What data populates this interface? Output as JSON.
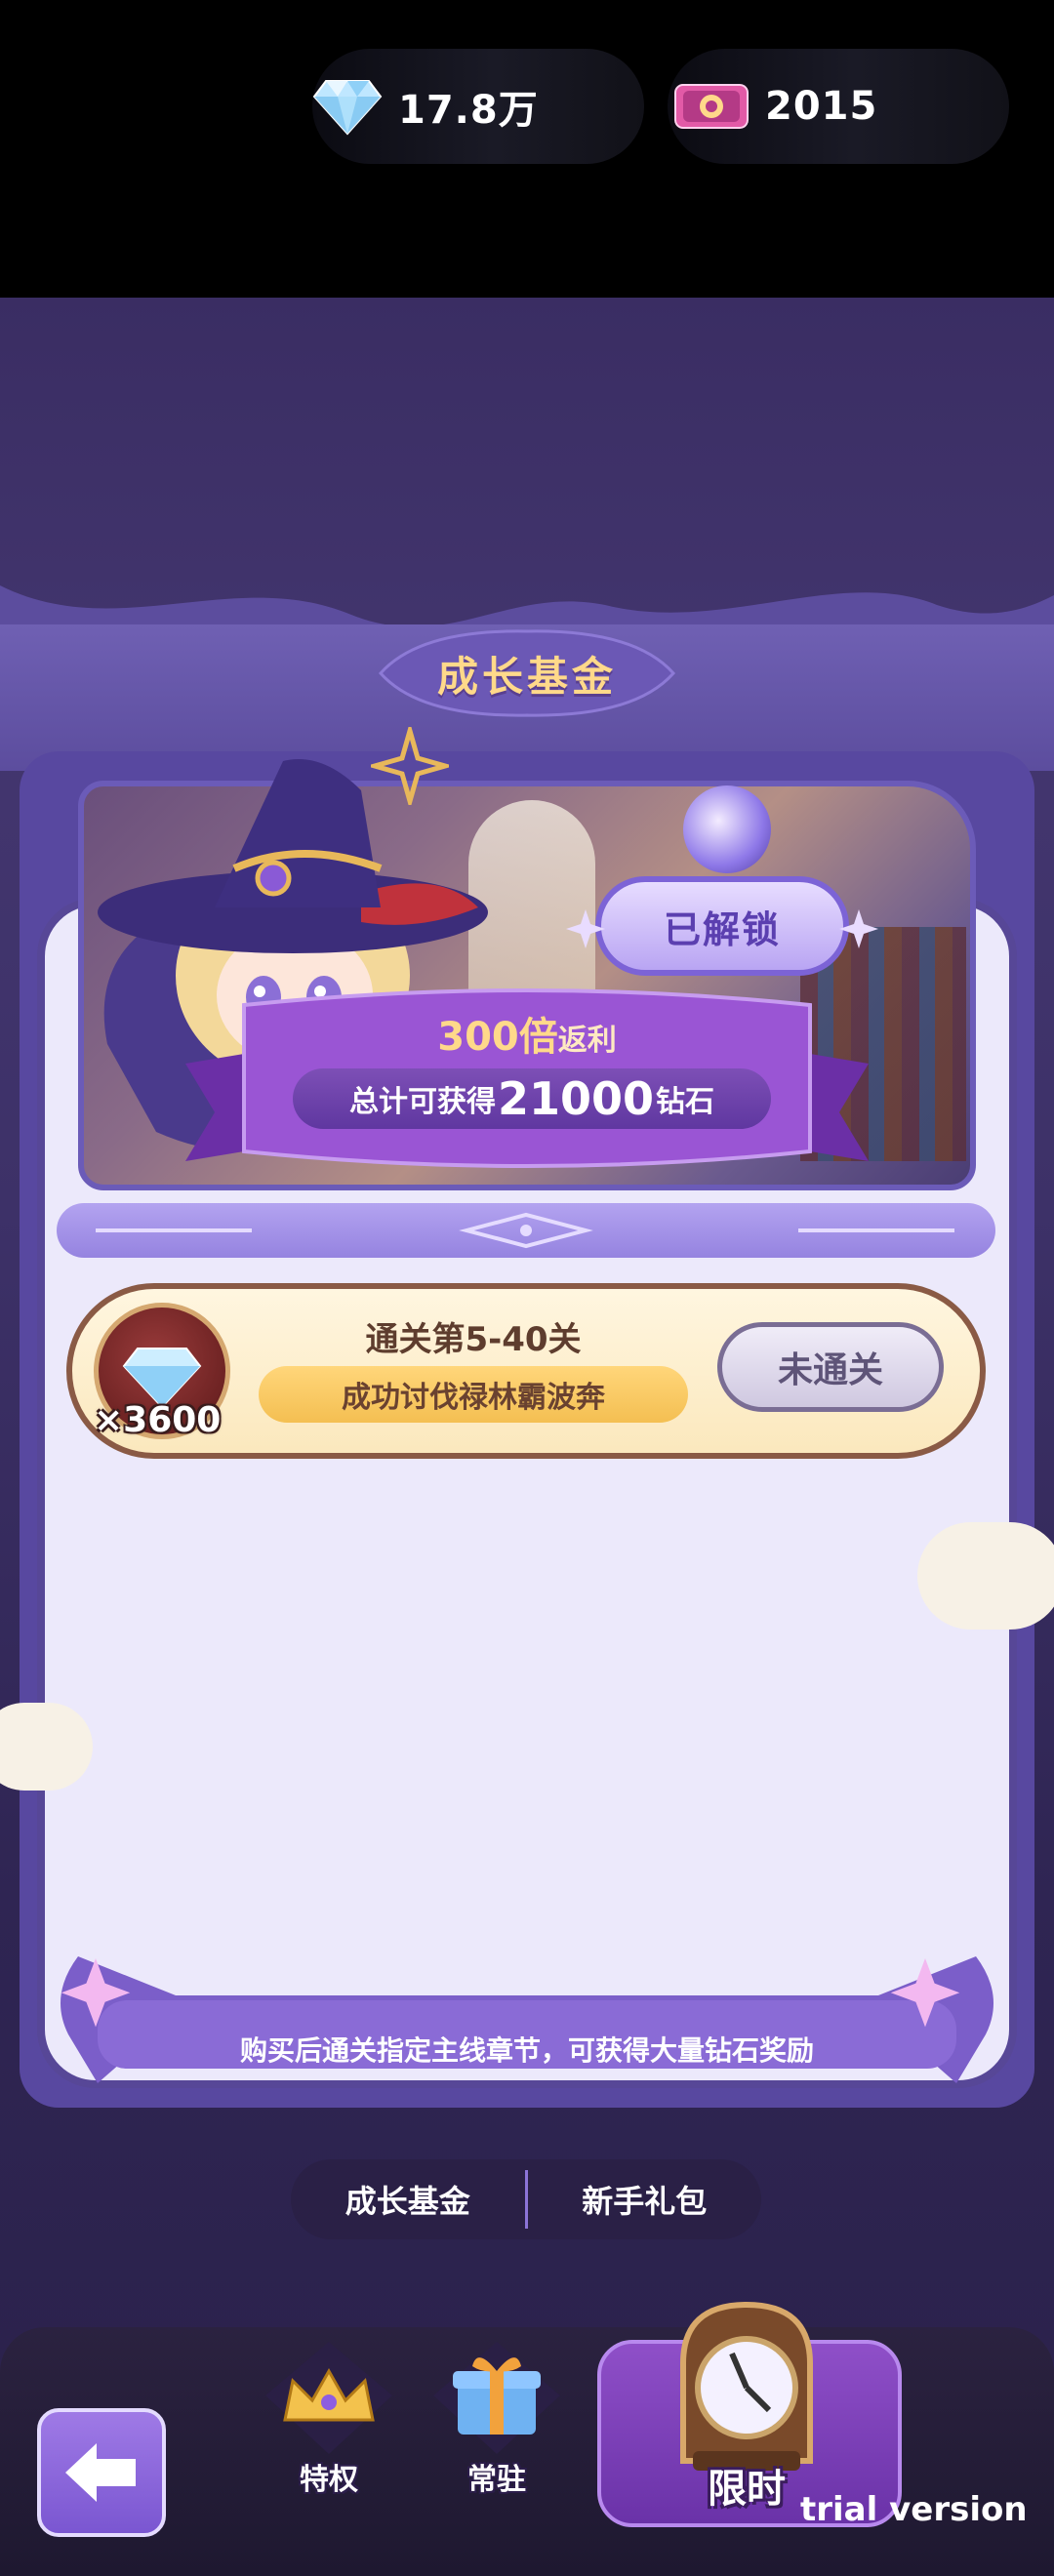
{
  "currency": {
    "diamonds": "17.8万",
    "tickets": "2015",
    "diamond_icon": "diamond-icon",
    "ticket_icon": "ticket-icon"
  },
  "header": {
    "title": "成长基金"
  },
  "banner": {
    "status": "已解锁",
    "multiplier": "300倍",
    "multiplier_suffix": "返利",
    "total_prefix": "总计可获得",
    "total_amount": "21000",
    "total_suffix": "钻石"
  },
  "reward": {
    "quantity": "×3600",
    "title": "通关第5-40关",
    "subtitle": "成功讨伐禄林霸波奔",
    "button": "未通关"
  },
  "footer_note": "购买后通关指定主线章节，可获得大量钻石奖励",
  "subtabs": [
    {
      "label": "成长基金",
      "active": true
    },
    {
      "label": "新手礼包",
      "active": false
    }
  ],
  "nav": {
    "privilege": "特权",
    "resident": "常驻",
    "timed": "限时"
  },
  "watermark": "trial version",
  "colors": {
    "accent_purple": "#5848a0",
    "gold_text": "#ffd98a",
    "panel_bg": "#ece9fb"
  }
}
